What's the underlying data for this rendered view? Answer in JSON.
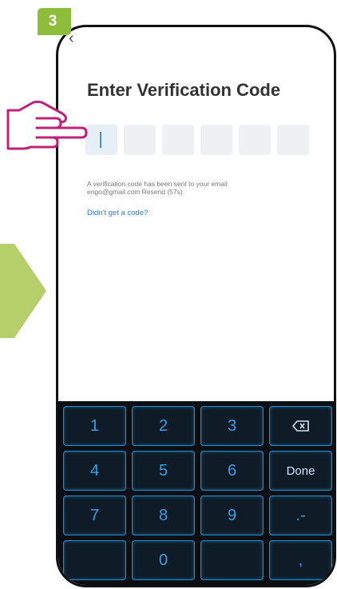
{
  "step": {
    "number": "3"
  },
  "screen": {
    "back_icon": "‹",
    "title": "Enter Verification Code",
    "code_boxes": [
      "",
      "",
      "",
      "",
      "",
      ""
    ],
    "info_line1": "A verification code has been sent to your email",
    "info_line2_email": "engo@gmail.com",
    "info_line2_resend": "Resend (57s)",
    "help_link": "Didn't get a code?"
  },
  "keyboard": {
    "row1": [
      "1",
      "2",
      "3",
      "⌫"
    ],
    "row2": [
      "4",
      "5",
      "6",
      "Done"
    ],
    "row3": [
      "7",
      "8",
      "9",
      ".-"
    ],
    "row4": [
      "",
      "0",
      "",
      ","
    ]
  },
  "colors": {
    "accent": "#c0217a",
    "arrow": "#b5cf6b",
    "badge": "#8dbd3b",
    "link": "#2c7be5"
  }
}
